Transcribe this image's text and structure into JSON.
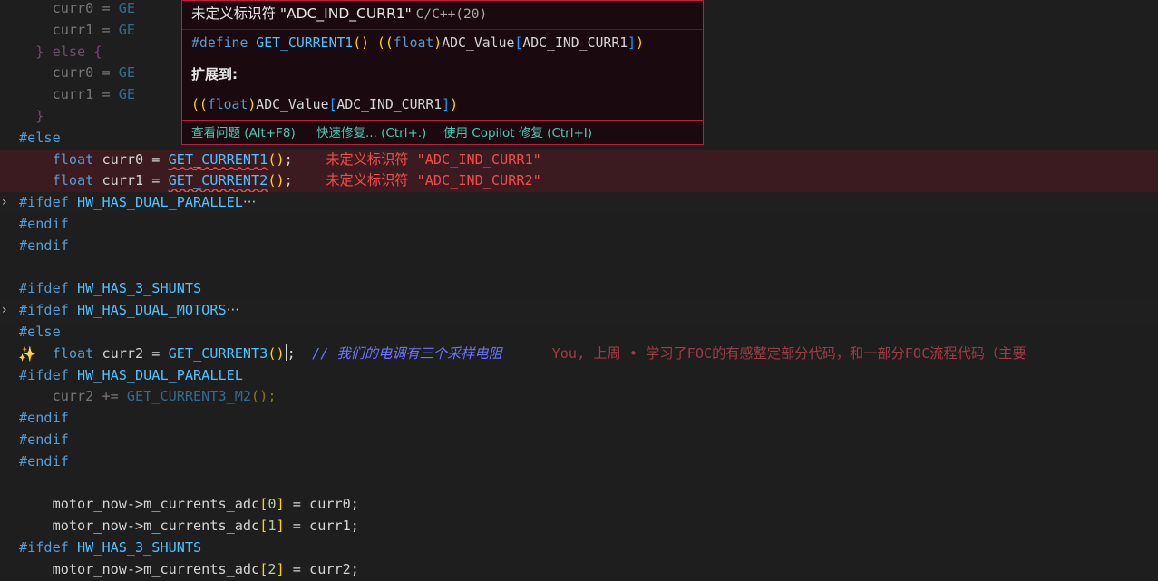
{
  "editor": {
    "lines": [
      {
        "kind": "dim",
        "tokens": [
          [
            "    ",
            "c-var"
          ],
          [
            "curr0",
            "c-var"
          ],
          [
            " = ",
            "c-op"
          ],
          [
            "GE",
            "c-macro"
          ]
        ]
      },
      {
        "kind": "dim",
        "tokens": [
          [
            "    ",
            "c-var"
          ],
          [
            "curr1",
            "c-var"
          ],
          [
            " = ",
            "c-op"
          ],
          [
            "GE",
            "c-macro"
          ]
        ]
      },
      {
        "kind": "dim",
        "tokens": [
          [
            "  ",
            "c-var"
          ],
          [
            "}",
            "c-br2"
          ],
          [
            " ",
            "c-var"
          ],
          [
            "else",
            "c-ctrl"
          ],
          [
            " ",
            "c-var"
          ],
          [
            "{",
            "c-br2"
          ]
        ]
      },
      {
        "kind": "dim",
        "tokens": [
          [
            "    ",
            "c-var"
          ],
          [
            "curr0",
            "c-var"
          ],
          [
            " = ",
            "c-op"
          ],
          [
            "GE",
            "c-macro"
          ]
        ]
      },
      {
        "kind": "dim",
        "tokens": [
          [
            "    ",
            "c-var"
          ],
          [
            "curr1",
            "c-var"
          ],
          [
            " = ",
            "c-op"
          ],
          [
            "GE",
            "c-macro"
          ]
        ]
      },
      {
        "kind": "dim",
        "tokens": [
          [
            "  ",
            "c-var"
          ],
          [
            "}",
            "c-br2"
          ]
        ]
      },
      {
        "kind": "",
        "tokens": [
          [
            "#else",
            "c-pp"
          ]
        ]
      },
      {
        "kind": "err",
        "tokens": [
          [
            "    ",
            "c-var"
          ],
          [
            "float",
            "c-kw"
          ],
          [
            " curr0 = ",
            "c-var"
          ],
          [
            "GET_CURRENT1",
            "c-macro squig"
          ],
          [
            "()",
            "c-br1"
          ],
          [
            ";",
            "c-punct"
          ],
          [
            "    ",
            "c-var"
          ],
          [
            "未定义标识符 \"ADC_IND_CURR1\"",
            "c-diag"
          ]
        ]
      },
      {
        "kind": "err",
        "tokens": [
          [
            "    ",
            "c-var"
          ],
          [
            "float",
            "c-kw"
          ],
          [
            " curr1 = ",
            "c-var"
          ],
          [
            "GET_CURRENT2",
            "c-macro squig"
          ],
          [
            "()",
            "c-br1"
          ],
          [
            ";",
            "c-punct"
          ],
          [
            "    ",
            "c-var"
          ],
          [
            "未定义标识符 \"ADC_IND_CURR2\"",
            "c-diag"
          ]
        ]
      },
      {
        "kind": "folded",
        "fold": "›",
        "tokens": [
          [
            "#ifdef ",
            "c-pp"
          ],
          [
            "HW_HAS_DUAL_PARALLEL",
            "c-macro"
          ],
          [
            "···",
            "c-ellip"
          ]
        ]
      },
      {
        "kind": "",
        "tokens": [
          [
            "#endif",
            "c-pp"
          ]
        ]
      },
      {
        "kind": "",
        "tokens": [
          [
            "#endif",
            "c-pp"
          ]
        ]
      },
      {
        "kind": "",
        "tokens": []
      },
      {
        "kind": "",
        "tokens": [
          [
            "#ifdef ",
            "c-pp"
          ],
          [
            "HW_HAS_3_SHUNTS",
            "c-macro"
          ]
        ]
      },
      {
        "kind": "folded",
        "fold": "›",
        "tokens": [
          [
            "#ifdef ",
            "c-pp"
          ],
          [
            "HW_HAS_DUAL_MOTORS",
            "c-macro"
          ],
          [
            "···",
            "c-ellip"
          ]
        ]
      },
      {
        "kind": "",
        "tokens": [
          [
            "#else",
            "c-pp"
          ]
        ]
      },
      {
        "kind": "cursor",
        "spark": "✨",
        "tokens": [
          [
            "    ",
            "c-var"
          ],
          [
            "float",
            "c-kw"
          ],
          [
            " curr2 = ",
            "c-var"
          ],
          [
            "GET_CURRENT3",
            "c-macro"
          ],
          [
            "()",
            "c-br1"
          ],
          [
            "|CURSOR|",
            ""
          ],
          [
            ";",
            "c-punct"
          ],
          [
            "  ",
            "c-var"
          ],
          [
            "// 我们的电调有三个采样电阻",
            "c-com2"
          ],
          [
            "      ",
            "c-var"
          ],
          [
            "You, 上周 • 学习了FOC的有感整定部分代码，和一部分FOC流程代码（主要",
            "c-blame"
          ]
        ]
      },
      {
        "kind": "",
        "tokens": [
          [
            "#ifdef ",
            "c-pp"
          ],
          [
            "HW_HAS_DUAL_PARALLEL",
            "c-macro"
          ]
        ]
      },
      {
        "kind": "dim",
        "tokens": [
          [
            "    ",
            "c-var"
          ],
          [
            "curr2 += ",
            "c-var"
          ],
          [
            "GET_CURRENT3_M2",
            "c-macro"
          ],
          [
            "();",
            "c-br1"
          ]
        ]
      },
      {
        "kind": "",
        "tokens": [
          [
            "#endif",
            "c-pp"
          ]
        ]
      },
      {
        "kind": "",
        "tokens": [
          [
            "#endif",
            "c-pp"
          ]
        ]
      },
      {
        "kind": "",
        "tokens": [
          [
            "#endif",
            "c-pp"
          ]
        ]
      },
      {
        "kind": "",
        "tokens": []
      },
      {
        "kind": "",
        "tokens": [
          [
            "    ",
            "c-var"
          ],
          [
            "motor_now",
            "c-var"
          ],
          [
            "->",
            "c-op"
          ],
          [
            "m_currents_adc",
            "c-var"
          ],
          [
            "[",
            "c-br1"
          ],
          [
            "0",
            "c-num"
          ],
          [
            "]",
            "c-br1"
          ],
          [
            " = curr0;",
            "c-var"
          ]
        ]
      },
      {
        "kind": "",
        "tokens": [
          [
            "    ",
            "c-var"
          ],
          [
            "motor_now",
            "c-var"
          ],
          [
            "->",
            "c-op"
          ],
          [
            "m_currents_adc",
            "c-var"
          ],
          [
            "[",
            "c-br1"
          ],
          [
            "1",
            "c-num"
          ],
          [
            "]",
            "c-br1"
          ],
          [
            " = curr1;",
            "c-var"
          ]
        ]
      },
      {
        "kind": "",
        "tokens": [
          [
            "#ifdef ",
            "c-pp"
          ],
          [
            "HW_HAS_3_SHUNTS",
            "c-macro"
          ]
        ]
      },
      {
        "kind": "",
        "tokens": [
          [
            "    ",
            "c-var"
          ],
          [
            "motor_now",
            "c-var"
          ],
          [
            "->",
            "c-op"
          ],
          [
            "m_currents_adc",
            "c-var"
          ],
          [
            "[",
            "c-br1"
          ],
          [
            "2",
            "c-num"
          ],
          [
            "]",
            "c-br1"
          ],
          [
            " = curr2;",
            "c-var"
          ]
        ]
      }
    ]
  },
  "hover": {
    "title": "未定义标识符 \"ADC_IND_CURR1\"",
    "source": "C/C++(20)",
    "define_line": [
      [
        "#define ",
        "c-pp"
      ],
      [
        "GET_CURRENT1",
        "c-macro"
      ],
      [
        "() ",
        "c-br1"
      ],
      [
        "((",
        "c-br1"
      ],
      [
        "float",
        "c-kw"
      ],
      [
        ")",
        "c-br1"
      ],
      [
        "ADC_Value",
        "c-var"
      ],
      [
        "[",
        "c-br3"
      ],
      [
        "ADC_IND_CURR1",
        "c-var"
      ],
      [
        "]",
        "c-br3"
      ],
      [
        ")",
        "c-br1"
      ]
    ],
    "expand_label": "扩展到:",
    "expand_line": [
      [
        "((",
        "c-br1"
      ],
      [
        "float",
        "c-kw"
      ],
      [
        ")",
        "c-br1"
      ],
      [
        "ADC_Value",
        "c-var"
      ],
      [
        "[",
        "c-br3"
      ],
      [
        "ADC_IND_CURR1",
        "c-var"
      ],
      [
        "]",
        "c-br3"
      ],
      [
        ")",
        "c-br1"
      ]
    ],
    "actions": {
      "view_problem": "查看问题 (Alt+F8)",
      "quick_fix": "快速修复... (Ctrl+.)",
      "copilot_fix": "使用 Copilot 修复 (Ctrl+I)"
    }
  },
  "colors": {
    "background": "#1e1e1e",
    "error": "#f14c4c",
    "hover_border": "#be1e3c",
    "action_link": "#4ec9b0"
  }
}
